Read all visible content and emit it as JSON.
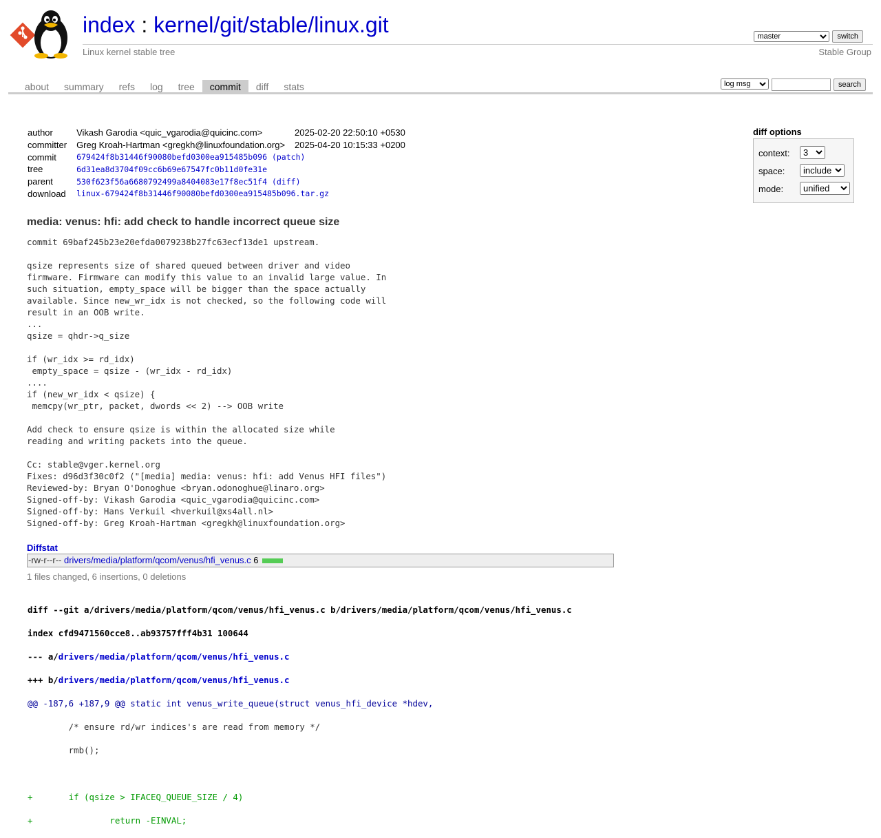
{
  "header": {
    "title_index": "index",
    "title_sep": " : ",
    "repo_path": "kernel/git/stable/linux.git",
    "subtitle": "Linux kernel stable tree",
    "owner": "Stable Group",
    "branch_selected": "master",
    "switch_label": "switch"
  },
  "tabs": [
    {
      "label": "about"
    },
    {
      "label": "summary"
    },
    {
      "label": "refs"
    },
    {
      "label": "log"
    },
    {
      "label": "tree"
    },
    {
      "label": "commit",
      "active": true
    },
    {
      "label": "diff"
    },
    {
      "label": "stats"
    }
  ],
  "search": {
    "scope": "log msg",
    "value": "",
    "button_label": "search"
  },
  "commit_info": {
    "author_label": "author",
    "author": "Vikash Garodia <quic_vgarodia@quicinc.com>",
    "author_date": "2025-02-20 22:50:10 +0530",
    "committer_label": "committer",
    "committer": "Greg Kroah-Hartman <gregkh@linuxfoundation.org>",
    "committer_date": "2025-04-20 10:15:33 +0200",
    "commit_label": "commit",
    "commit_hash": "679424f8b31446f90080befd0300ea915485b096",
    "patch_link": "(patch)",
    "tree_label": "tree",
    "tree_hash": "6d31ea8d3704f09cc6b69e67547fc0b11d0fe31e",
    "parent_label": "parent",
    "parent_hash": "530f623f56a6680792499a8404083e17f8ec51f4",
    "diff_link": "(diff)",
    "download_label": "download",
    "download_file": "linux-679424f8b31446f90080befd0300ea915485b096.tar.gz"
  },
  "diff_options": {
    "header": "diff options",
    "context_label": "context:",
    "context_value": "3",
    "space_label": "space:",
    "space_value": "include",
    "mode_label": "mode:",
    "mode_value": "unified"
  },
  "message": {
    "subject": "media: venus: hfi: add check to handle incorrect queue size",
    "body": "commit 69baf245b23e20efda0079238b27fc63ecf13de1 upstream.\n\nqsize represents size of shared queued between driver and video\nfirmware. Firmware can modify this value to an invalid large value. In\nsuch situation, empty_space will be bigger than the space actually\navailable. Since new_wr_idx is not checked, so the following code will\nresult in an OOB write.\n...\nqsize = qhdr->q_size\n\nif (wr_idx >= rd_idx)\n empty_space = qsize - (wr_idx - rd_idx)\n....\nif (new_wr_idx < qsize) {\n memcpy(wr_ptr, packet, dwords << 2) --> OOB write\n\nAdd check to ensure qsize is within the allocated size while\nreading and writing packets into the queue.\n\nCc: stable@vger.kernel.org\nFixes: d96d3f30c0f2 (\"[media] media: venus: hfi: add Venus HFI files\")\nReviewed-by: Bryan O'Donoghue <bryan.odonoghue@linaro.org>\nSigned-off-by: Vikash Garodia <quic_vgarodia@quicinc.com>\nSigned-off-by: Hans Verkuil <hverkuil@xs4all.nl>\nSigned-off-by: Greg Kroah-Hartman <gregkh@linuxfoundation.org>"
  },
  "diffstat": {
    "header": "Diffstat",
    "mode": "-rw-r--r--",
    "file": "drivers/media/platform/qcom/venus/hfi_venus.c",
    "count": "6",
    "summary": "1 files changed, 6 insertions, 0 deletions"
  },
  "diff": {
    "git_line_prefix": "diff --git a/drivers/media/platform/qcom/venus/hfi_venus.c b/drivers/media/platform/qcom/venus/hfi_venus.c",
    "index_line": "index cfd9471560cce8..ab93757fff4b31 100644",
    "minus_prefix": "--- a/",
    "minus_file": "drivers/media/platform/qcom/venus/hfi_venus.c",
    "plus_prefix": "+++ b/",
    "plus_file": "drivers/media/platform/qcom/venus/hfi_venus.c",
    "hunk": "@@ -187,6 +187,9 @@ static int venus_write_queue(struct venus_hfi_device *hdev,",
    "ctx1": "        /* ensure rd/wr indices's are read from memory */",
    "ctx2": "        rmb();",
    "ctx3": "",
    "add1": "+       if (qsize > IFACEQ_QUEUE_SIZE / 4)",
    "add2": "+               return -EINVAL;"
  }
}
